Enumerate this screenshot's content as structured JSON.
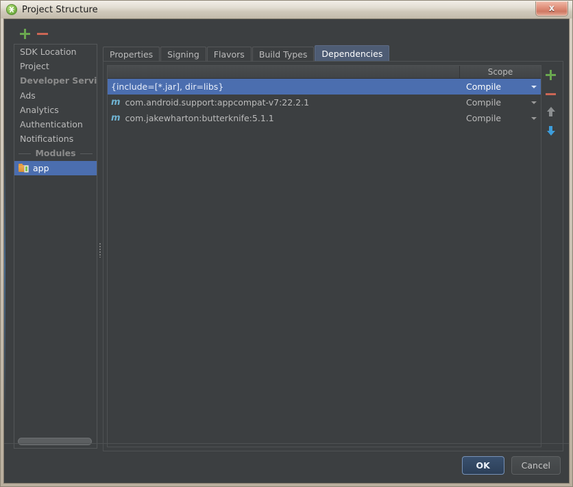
{
  "window": {
    "title": "Project Structure",
    "icon": "android-studio-icon",
    "close_label": "x"
  },
  "toolbar": {
    "add_label": "+",
    "remove_label": "−"
  },
  "sidebar": {
    "items": [
      {
        "label": "SDK Location",
        "type": "item",
        "selected": false
      },
      {
        "label": "Project",
        "type": "item",
        "selected": false
      },
      {
        "label": "Developer Services",
        "type": "group"
      },
      {
        "label": "Ads",
        "type": "item",
        "selected": false
      },
      {
        "label": "Analytics",
        "type": "item",
        "selected": false
      },
      {
        "label": "Authentication",
        "type": "item",
        "selected": false
      },
      {
        "label": "Notifications",
        "type": "item",
        "selected": false
      },
      {
        "label": "Modules",
        "type": "group-centered"
      },
      {
        "label": "app",
        "type": "module",
        "selected": true,
        "icon": "app-module-icon"
      }
    ]
  },
  "tabs": [
    {
      "label": "Properties",
      "active": false
    },
    {
      "label": "Signing",
      "active": false
    },
    {
      "label": "Flavors",
      "active": false
    },
    {
      "label": "Build Types",
      "active": false
    },
    {
      "label": "Dependencies",
      "active": true
    }
  ],
  "table": {
    "headers": {
      "name": "",
      "scope": "Scope"
    },
    "rows": [
      {
        "name": "{include=[*.jar], dir=libs}",
        "scope": "Compile",
        "icon": null,
        "selected": true
      },
      {
        "name": "com.android.support:appcompat-v7:22.2.1",
        "scope": "Compile",
        "icon": "m",
        "selected": false
      },
      {
        "name": "com.jakewharton:butterknife:5.1.1",
        "scope": "Compile",
        "icon": "m",
        "selected": false
      }
    ]
  },
  "rail": {
    "add_label": "+",
    "remove_label": "−",
    "move_up": "move-up",
    "move_down": "move-down"
  },
  "footer": {
    "ok_label": "OK",
    "cancel_label": "Cancel"
  },
  "colors": {
    "selection_blue": "#4b6eaf",
    "active_tab": "#4e5c74",
    "panel_bg": "#3c3f41",
    "add_green": "#6aa84f",
    "remove_red": "#cc6655",
    "arrow_blue": "#3d9ddb",
    "module_icon": "#6fb3d2"
  }
}
